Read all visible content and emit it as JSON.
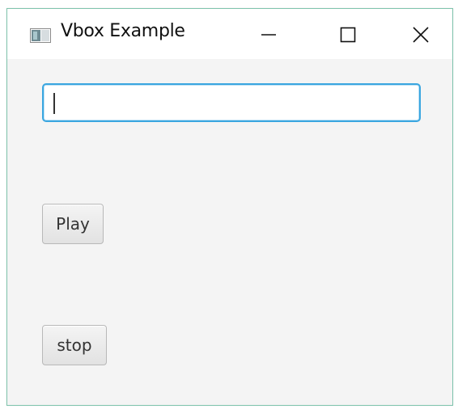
{
  "window": {
    "title": "Vbox Example",
    "controls": {
      "minimize_icon": "minimize-icon",
      "maximize_icon": "maximize-icon",
      "close_icon": "close-icon"
    }
  },
  "main": {
    "text_field": {
      "value": "",
      "placeholder": ""
    },
    "play_label": "Play",
    "stop_label": "stop"
  },
  "colors": {
    "focus_border": "#3aa6e0",
    "window_border": "#7fc4ad",
    "background": "#f4f4f4"
  }
}
